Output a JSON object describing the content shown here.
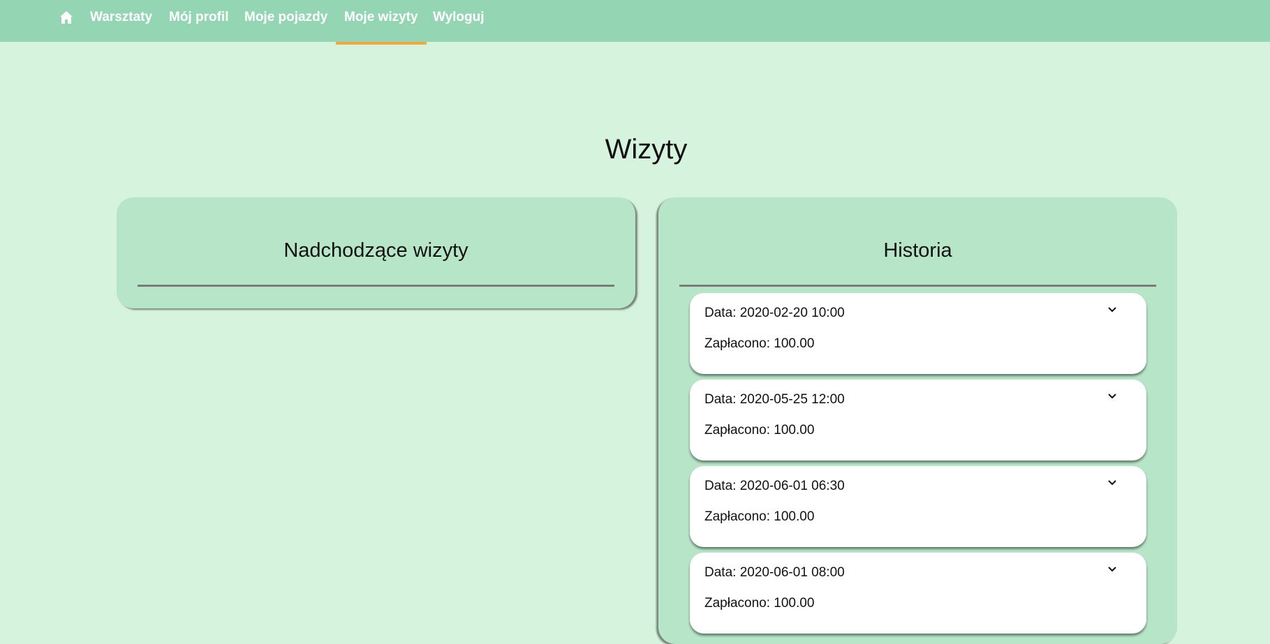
{
  "nav": {
    "home_icon": "home-icon",
    "items": [
      {
        "label": "Warsztaty"
      },
      {
        "label": "Mój profil"
      },
      {
        "label": "Moje pojazdy"
      },
      {
        "label": "Moje wizyty",
        "active": true
      },
      {
        "label": "Wyloguj"
      }
    ]
  },
  "page": {
    "title": "Wizyty"
  },
  "upcoming": {
    "title": "Nadchodzące wizyty",
    "visits": []
  },
  "history": {
    "title": "Historia",
    "visits": [
      {
        "date": "Data: 2020-02-20 10:00",
        "paid": "Zapłacono: 100.00"
      },
      {
        "date": "Data: 2020-05-25 12:00",
        "paid": "Zapłacono: 100.00"
      },
      {
        "date": "Data: 2020-06-01 06:30",
        "paid": "Zapłacono: 100.00"
      },
      {
        "date": "Data: 2020-06-01 08:00",
        "paid": "Zapłacono: 100.00"
      }
    ]
  },
  "colors": {
    "background": "#d6f3dd",
    "navbar": "#94d6b3",
    "panel": "#b6e5c8",
    "active_underline": "#f2a93b"
  }
}
